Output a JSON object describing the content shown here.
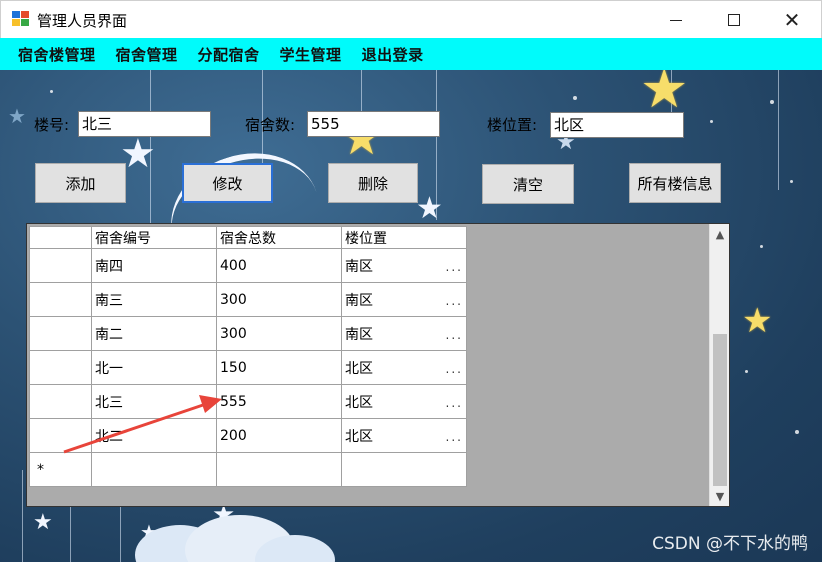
{
  "window": {
    "title": "管理人员界面"
  },
  "menu": [
    "宿舍楼管理",
    "宿舍管理",
    "分配宿舍",
    "学生管理",
    "退出登录"
  ],
  "form": {
    "building_no_label": "楼号:",
    "building_no_value": "北三",
    "dorm_count_label": "宿舍数:",
    "dorm_count_value": "555",
    "location_label": "楼位置:",
    "location_value": "北区"
  },
  "buttons": {
    "add": "添加",
    "edit": "修改",
    "delete": "删除",
    "clear": "清空",
    "all_info": "所有楼信息"
  },
  "grid": {
    "columns": [
      "宿舍编号",
      "宿舍总数",
      "楼位置"
    ],
    "rows": [
      [
        "南四",
        "400",
        "南区"
      ],
      [
        "南三",
        "300",
        "南区"
      ],
      [
        "南二",
        "300",
        "南区"
      ],
      [
        "北一",
        "150",
        "北区"
      ],
      [
        "北三",
        "555",
        "北区"
      ],
      [
        "北二",
        "200",
        "北区"
      ]
    ],
    "ellipsis": "...",
    "new_row_marker": "*"
  },
  "watermark": "CSDN @不下水的鸭",
  "colors": {
    "menu_bg": "#00fbfb",
    "annotation_arrow": "#e8443a",
    "focus_border": "#2a6fd6"
  }
}
